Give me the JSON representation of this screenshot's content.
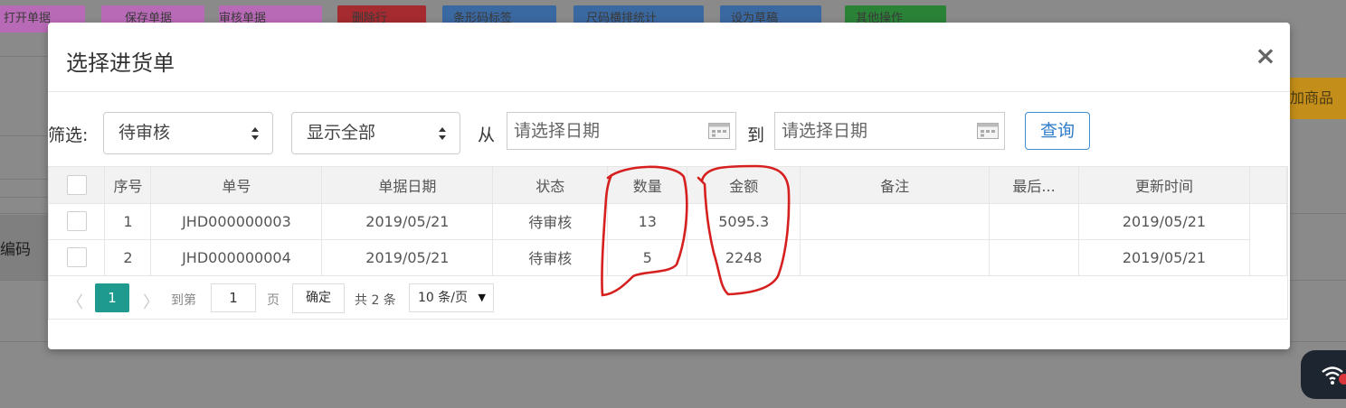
{
  "background": {
    "toolbar_buttons": [
      {
        "label": "打开单据",
        "color": "#c26fc0"
      },
      {
        "label": "保存单据",
        "color": "#c26fc0"
      },
      {
        "label": "审核单据",
        "color": "#c26fc0"
      },
      {
        "label": "删除行",
        "color": "#b13037"
      },
      {
        "label": "条形码标签",
        "color": "#3f72b0"
      },
      {
        "label": "尺码横排统计",
        "color": "#3f72b0"
      },
      {
        "label": "设为草稿",
        "color": "#3f72b0"
      },
      {
        "label": "其他操作",
        "color": "#2e8e3b"
      }
    ],
    "side_button_label": "加商品",
    "left_label": "编码"
  },
  "modal": {
    "title": "选择进货单",
    "close": "×"
  },
  "filter": {
    "label": "筛选:",
    "status_select": "待审核",
    "display_select": "显示全部",
    "from_label": "从",
    "to_label": "到",
    "start_date_placeholder": "请选择日期",
    "end_date_placeholder": "请选择日期",
    "query_button": "查询"
  },
  "table": {
    "columns": [
      "",
      "序号",
      "单号",
      "单据日期",
      "状态",
      "数量",
      "金额",
      "备注",
      "最后...",
      "更新时间"
    ],
    "rows": [
      {
        "seq": "1",
        "order_no": "JHD000000003",
        "date": "2019/05/21",
        "status": "待审核",
        "qty": "13",
        "amount": "5095.3",
        "remark": "",
        "last": "",
        "updated": "2019/05/21"
      },
      {
        "seq": "2",
        "order_no": "JHD000000004",
        "date": "2019/05/21",
        "status": "待审核",
        "qty": "5",
        "amount": "2248",
        "remark": "",
        "last": "",
        "updated": "2019/05/21"
      }
    ]
  },
  "pager": {
    "current_page": "1",
    "goto_label": "到第",
    "goto_value": "1",
    "page_label": "页",
    "confirm": "确定",
    "total": "共 2 条",
    "page_size": "10 条/页"
  },
  "annotation_color": "#d62020",
  "accent_color": "#1e9a8f"
}
